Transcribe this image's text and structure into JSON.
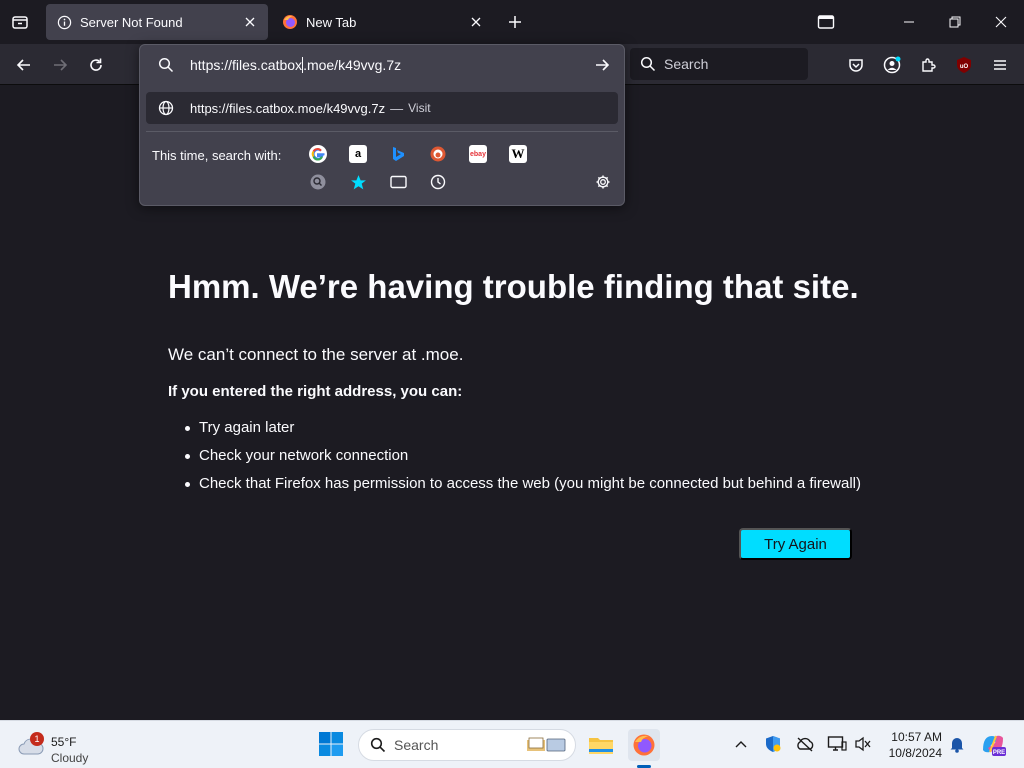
{
  "window": {
    "tabs": [
      {
        "label": "Server Not Found",
        "icon": "info-icon",
        "active": true
      },
      {
        "label": "New Tab",
        "icon": "firefox-icon",
        "active": false
      }
    ]
  },
  "toolbar": {
    "search_placeholder": "Search"
  },
  "urlbar": {
    "value_before_cursor": "https://files.catbox",
    "value_after_cursor": ".moe/k49vvg.7z",
    "suggestion_url": "https://files.catbox.moe/k49vvg.7z",
    "suggestion_separator": "—",
    "suggestion_action": "Visit",
    "onetime_label": "This time, search with:",
    "engines": [
      "Google",
      "Amazon",
      "Bing",
      "DuckDuckGo",
      "eBay",
      "Wikipedia"
    ],
    "engine_logos": {
      "amazon": "a",
      "ebay": "ebay",
      "wikipedia": "W"
    },
    "local_sources": [
      "search-icon",
      "bookmarks-icon",
      "tabs-icon",
      "history-icon"
    ]
  },
  "error_page": {
    "title": "Hmm. We’re having trouble finding that site.",
    "description": "We can’t connect to the server at .moe.",
    "subheading": "If you entered the right address, you can:",
    "suggestions": [
      "Try again later",
      "Check your network connection",
      "Check that Firefox has permission to access the web (you might be connected but behind a firewall)"
    ],
    "button_label": "Try Again"
  },
  "taskbar": {
    "weather_temp": "55°F",
    "weather_condition": "Cloudy",
    "weather_badge": "1",
    "search_label": "Search",
    "time": "10:57 AM",
    "date": "10/8/2024",
    "copilot_badge": "PRE"
  },
  "colors": {
    "accent": "#00ddff",
    "page_bg": "#1c1b22",
    "toolbar_bg": "#2b2a33",
    "panel_bg": "#42414d"
  }
}
